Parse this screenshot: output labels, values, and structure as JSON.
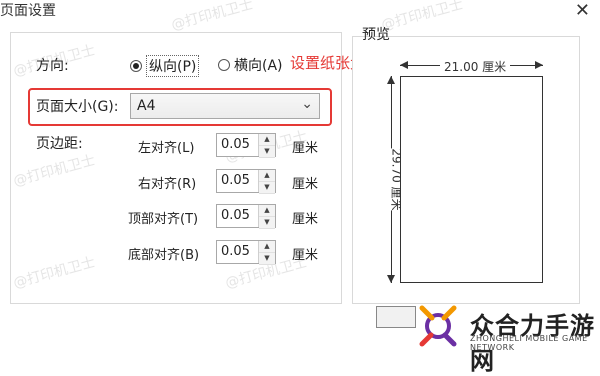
{
  "dialog": {
    "title": "页面设置",
    "close_glyph": "✕"
  },
  "orientation": {
    "label": "方向:",
    "portrait_label": "纵向(P)",
    "landscape_label": "横向(A)",
    "selected": "portrait"
  },
  "annotation": {
    "text": "设置纸张大小"
  },
  "paper_size": {
    "label": "页面大小(G):",
    "value": "A4"
  },
  "margins": {
    "label": "页边距:",
    "unit": "厘米",
    "items": [
      {
        "label": "左对齐(L)",
        "value": "0.05"
      },
      {
        "label": "右对齐(R)",
        "value": "0.05"
      },
      {
        "label": "顶部对齐(T)",
        "value": "0.05"
      },
      {
        "label": "底部对齐(B)",
        "value": "0.05"
      }
    ]
  },
  "preview": {
    "label": "预览",
    "width_text": "21.00 厘米",
    "height_text": "29.70 厘米"
  },
  "watermark": {
    "text": "@打印机卫士"
  },
  "logo": {
    "cn": "众合力手游网",
    "en": "ZHONGHELI MOBILE GAME NETWORK",
    "colors": {
      "orange": "#f39800",
      "purple": "#6b2fa3",
      "red": "#e53935"
    }
  },
  "colors": {
    "accent_red": "#e53935",
    "border": "#d9d9d9"
  }
}
